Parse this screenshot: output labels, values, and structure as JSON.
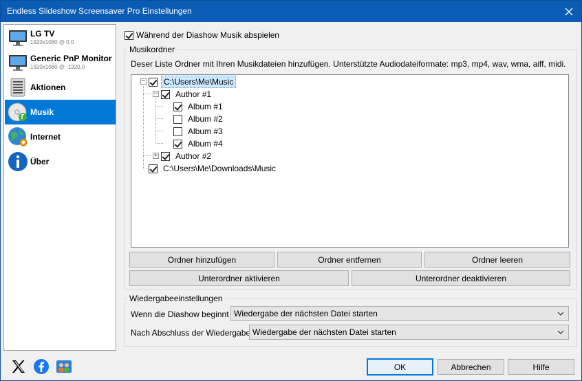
{
  "window": {
    "title": "Endless Slideshow Screensaver Pro Einstellungen"
  },
  "sidebar": {
    "items": [
      {
        "label": "LG TV",
        "sub": "1920x1080 @ 0,0",
        "icon": "monitor-icon"
      },
      {
        "label": "Generic PnP Monitor",
        "sub": "1920x1080 @ -1920,0",
        "icon": "monitor-icon"
      },
      {
        "label": "Aktionen",
        "icon": "list-icon"
      },
      {
        "label": "Musik",
        "icon": "music-disc-icon",
        "selected": true
      },
      {
        "label": "Internet",
        "icon": "globe-icon"
      },
      {
        "label": "Über",
        "icon": "info-icon"
      }
    ]
  },
  "music": {
    "play_label": "Während der Diashow Musik abspielen",
    "play_checked": true,
    "folders_group": "Musikordner",
    "description": "Deser Liste Ordner mit Ihren Musikdateien hinzufügen. Unterstützte Audiodateiformate: mp3, mp4, wav, wma, aiff, midi.",
    "tree": [
      {
        "label": "C:\\Users\\Me\\Music",
        "checked": true,
        "expander": "−",
        "selected": true
      },
      {
        "label": "Author #1",
        "checked": true,
        "expander": "−"
      },
      {
        "label": "Album #1",
        "checked": true
      },
      {
        "label": "Album #2",
        "checked": false
      },
      {
        "label": "Album #3",
        "checked": false
      },
      {
        "label": "Album #4",
        "checked": true
      },
      {
        "label": "Author #2",
        "checked": true,
        "expander": "+"
      },
      {
        "label": "C:\\Users\\Me\\Downloads\\Music",
        "checked": true
      }
    ],
    "buttons": {
      "add": "Ordner hinzufügen",
      "remove": "Ordner entfernen",
      "clear": "Ordner leeren",
      "activate_sub": "Unterordner aktivieren",
      "deactivate_sub": "Unterordner deaktivieren"
    }
  },
  "playback": {
    "group": "Wiedergabeeinstellungen",
    "start_label": "Wenn die Diashow beginnt",
    "start_value": "Wiedergabe der nächsten Datei starten",
    "end_label": "Nach Abschluss der Wiedergabe",
    "end_value": "Wiedergabe der nächsten Datei starten"
  },
  "footer": {
    "icons": [
      "x-logo-icon",
      "facebook-icon",
      "community-icon"
    ],
    "ok": "OK",
    "cancel": "Abbrechen",
    "help": "Hilfe"
  },
  "colors": {
    "titlebar": "#0a5cb5",
    "selection": "#0078d7"
  }
}
